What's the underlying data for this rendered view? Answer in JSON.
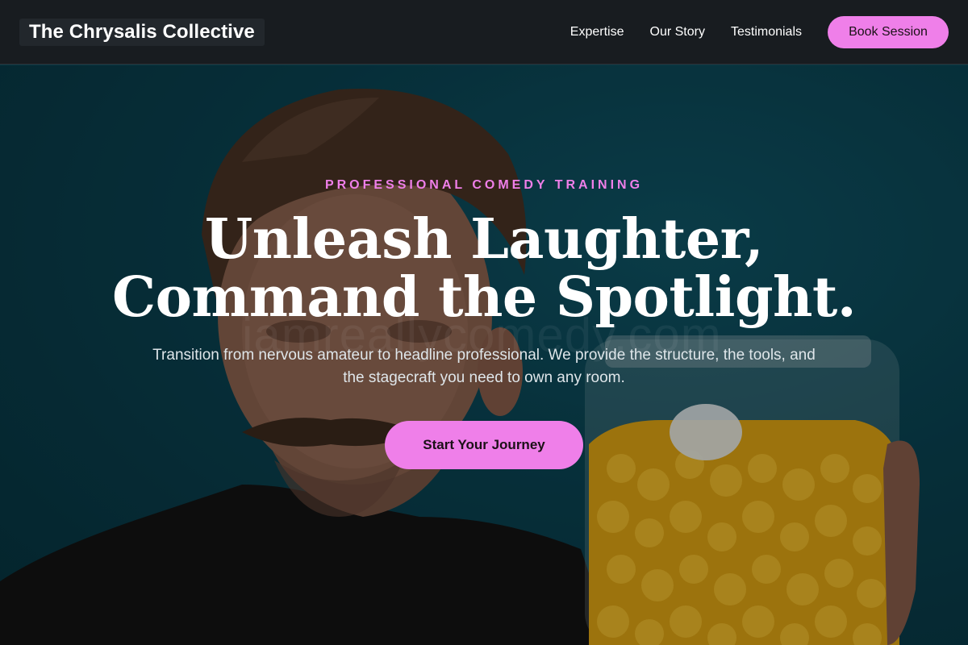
{
  "nav": {
    "brand": "The Chrysalis Collective",
    "links": [
      "Expertise",
      "Our Story",
      "Testimonials"
    ],
    "cta_label": "Book Session"
  },
  "hero": {
    "eyebrow": "PROFESSIONAL COMEDY TRAINING",
    "headline_line1": "Unleash Laughter,",
    "headline_line2": "Command the Spotlight.",
    "subcopy": "Transition from nervous amateur to headline professional. We provide the structure, the tools, and the stagecraft you need to own any room.",
    "cta_label": "Start Your Journey",
    "watermark": "iamreallycomedy.com"
  },
  "colors": {
    "accent": "#ef7fe9",
    "nav_bg": "#181c20",
    "hero_bg": "#0a4352"
  }
}
